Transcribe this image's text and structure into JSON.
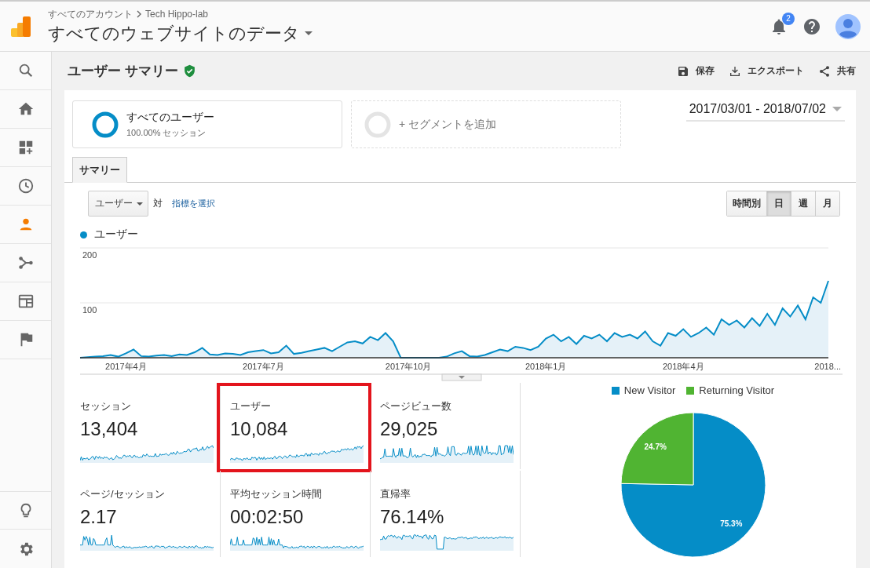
{
  "header": {
    "breadcrumb": [
      "すべてのアカウント",
      "Tech Hippo-lab"
    ],
    "title": "すべてのウェブサイトのデータ",
    "notification_count": "2"
  },
  "sidebar": {
    "items": [
      {
        "selected": false
      },
      {
        "selected": false
      },
      {
        "selected": false
      },
      {
        "selected": false
      },
      {
        "selected": true
      },
      {
        "selected": false
      },
      {
        "selected": false
      },
      {
        "selected": false
      }
    ]
  },
  "report": {
    "title": "ユーザー サマリー",
    "actions": [
      "保存",
      "エクスポート",
      "共有"
    ]
  },
  "segments": [
    {
      "name": "すべてのユーザー",
      "detail": "100.00% セッション"
    }
  ],
  "add_segment": "+ セグメントを追加",
  "date_range": "2017/03/01 - 2018/07/02",
  "tabs": [
    {
      "label": "サマリー",
      "selected": true
    }
  ],
  "metric_selector": {
    "value": "ユーザー",
    "versus": "対",
    "link": "指標を選択"
  },
  "intervals": [
    {
      "label": "時間別",
      "selected": false
    },
    {
      "label": "日",
      "selected": true
    },
    {
      "label": "週",
      "selected": false
    },
    {
      "label": "月",
      "selected": false
    }
  ],
  "chart": {
    "chart_data": {
      "type": "area",
      "ylim": [
        0,
        200
      ],
      "yticks": [
        100,
        200
      ],
      "categories": [
        null,
        null,
        null,
        null,
        null,
        null,
        "2017年4月",
        null,
        null,
        null,
        null,
        null,
        null,
        null,
        null,
        null,
        null,
        null,
        null,
        null,
        null,
        null,
        null,
        null,
        "2017年7月",
        null,
        null,
        null,
        null,
        null,
        null,
        null,
        null,
        null,
        null,
        null,
        null,
        null,
        null,
        null,
        null,
        null,
        null,
        "2017年10月",
        null,
        null,
        null,
        null,
        null,
        null,
        null,
        null,
        null,
        null,
        null,
        null,
        null,
        null,
        null,
        null,
        null,
        "2018年1月",
        null,
        null,
        null,
        null,
        null,
        null,
        null,
        null,
        null,
        null,
        null,
        null,
        null,
        null,
        null,
        null,
        null,
        "2018年4月",
        null,
        null,
        null,
        null,
        null,
        null,
        null,
        null,
        null,
        null,
        null,
        null,
        null,
        null,
        null,
        null,
        null,
        null,
        "2018..."
      ],
      "series": [
        {
          "name": "ユーザー",
          "color": "#058dc7",
          "values": [
            0,
            1,
            2,
            3,
            5,
            2,
            8,
            15,
            3,
            2,
            4,
            5,
            3,
            6,
            5,
            10,
            18,
            6,
            5,
            8,
            7,
            5,
            10,
            12,
            14,
            8,
            10,
            22,
            7,
            9,
            12,
            15,
            18,
            12,
            20,
            28,
            30,
            26,
            38,
            32,
            45,
            30,
            0,
            0,
            0,
            0,
            0,
            0,
            2,
            8,
            12,
            3,
            2,
            5,
            10,
            15,
            12,
            20,
            18,
            14,
            20,
            35,
            42,
            30,
            38,
            25,
            40,
            35,
            42,
            30,
            45,
            38,
            42,
            35,
            48,
            30,
            22,
            45,
            40,
            52,
            38,
            45,
            55,
            42,
            70,
            60,
            68,
            55,
            72,
            58,
            80,
            60,
            90,
            75,
            95,
            70,
            110,
            100,
            140
          ]
        }
      ]
    }
  },
  "metrics": [
    {
      "label": "セッション",
      "value": "13,404",
      "highlighted": false
    },
    {
      "label": "ユーザー",
      "value": "10,084",
      "highlighted": true
    },
    {
      "label": "ページビュー数",
      "value": "29,025",
      "highlighted": false
    },
    {
      "label": "ページ/セッション",
      "value": "2.17",
      "highlighted": false
    },
    {
      "label": "平均セッション時間",
      "value": "00:02:50",
      "highlighted": false
    },
    {
      "label": "直帰率",
      "value": "76.14%",
      "highlighted": false
    }
  ],
  "visitor_pie": {
    "legend": [
      {
        "color": "#058dc7"
      },
      {
        "color": "#50b432"
      }
    ],
    "chart_data": {
      "type": "pie",
      "categories": [
        "New Visitor",
        "Returning Visitor"
      ],
      "values": [
        75.3,
        24.7
      ],
      "value_labels": [
        "75.3%",
        "24.7%"
      ]
    }
  }
}
